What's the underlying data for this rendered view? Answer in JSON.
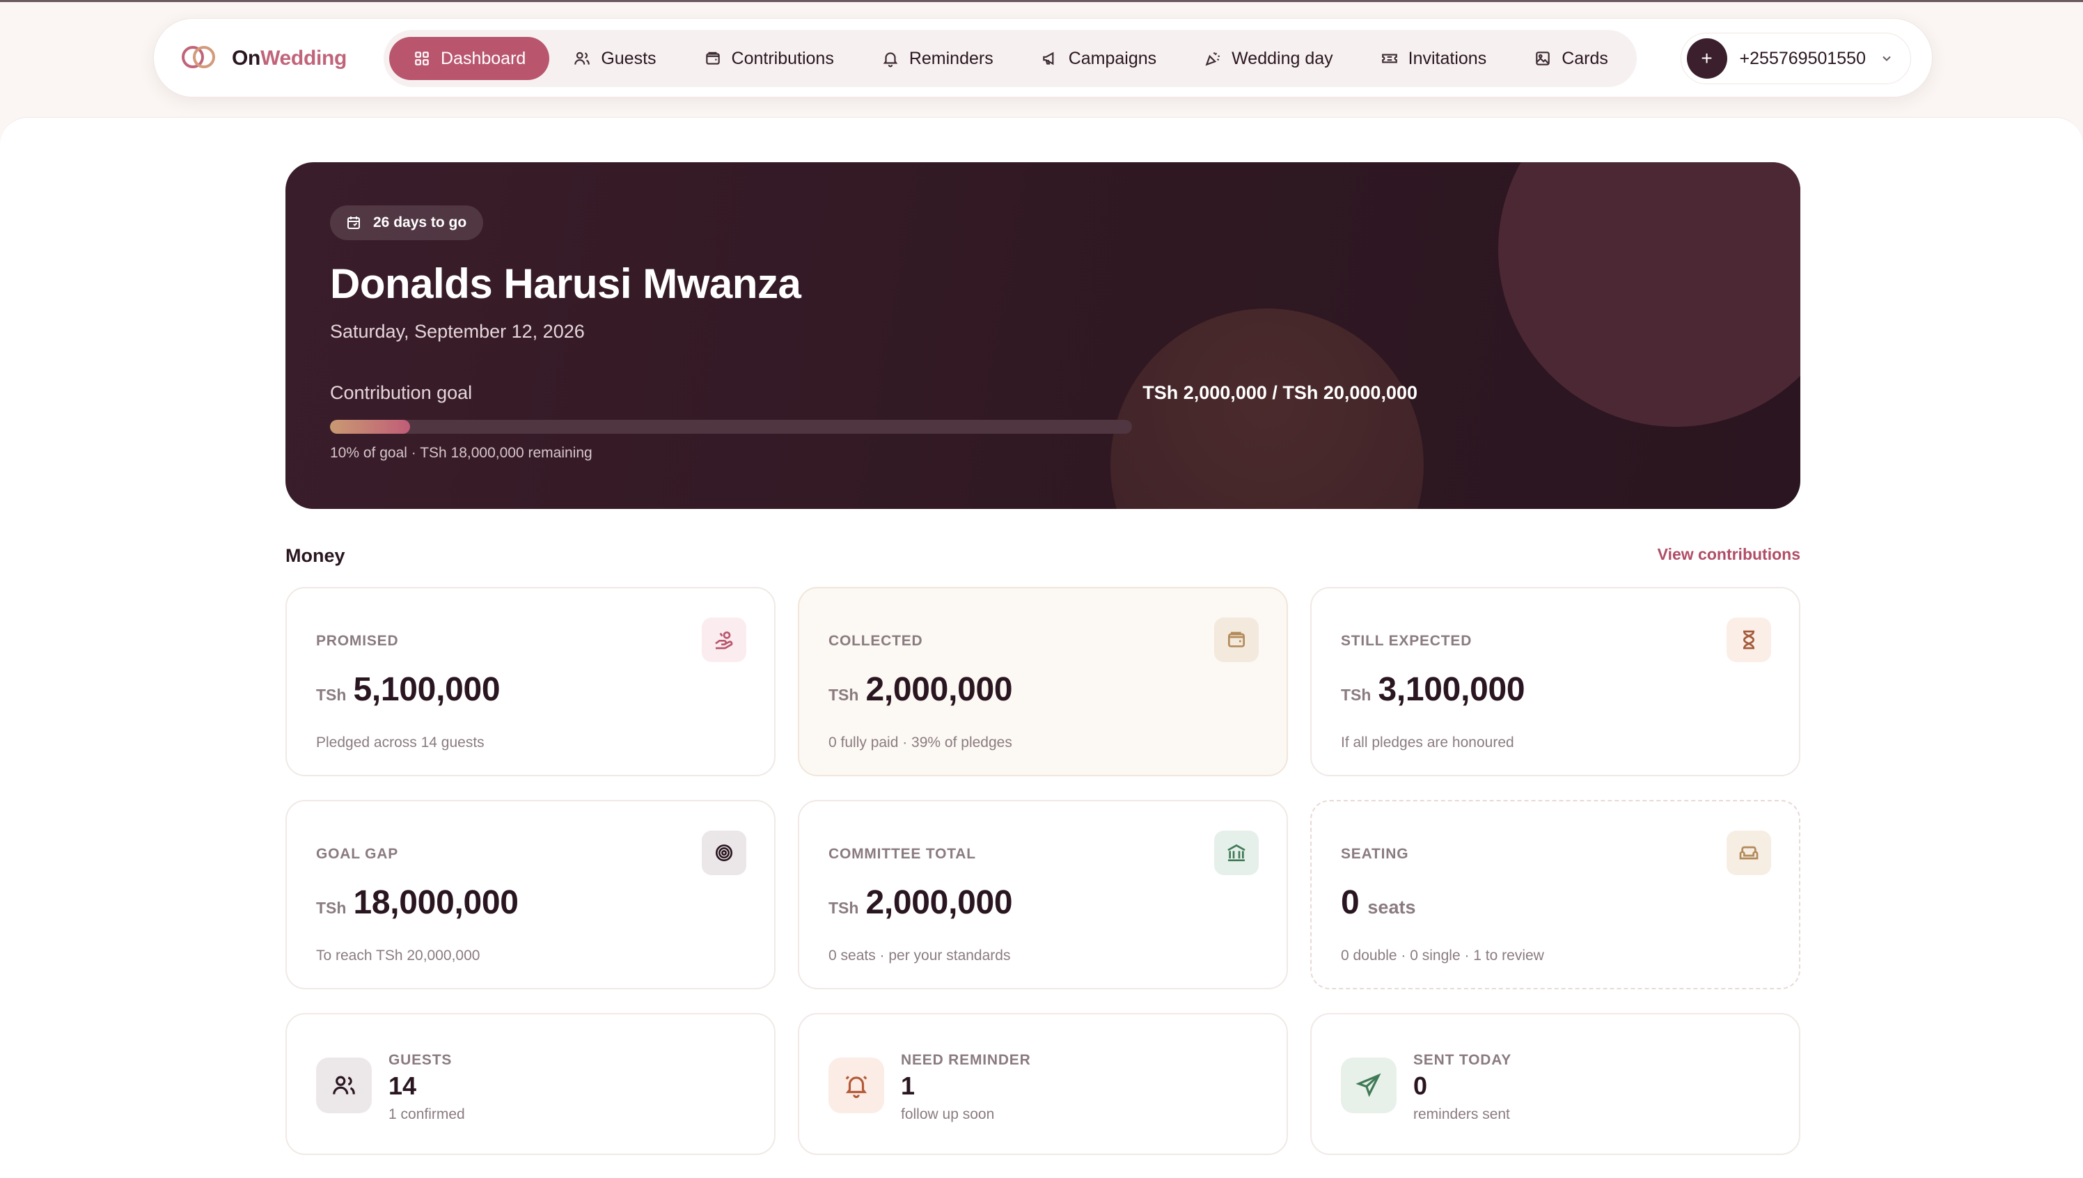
{
  "app": {
    "brand_on": "On",
    "brand_wedding": "Wedding"
  },
  "nav": {
    "tabs": [
      {
        "label": "Dashboard",
        "icon": "grid-icon",
        "active": true
      },
      {
        "label": "Guests",
        "icon": "users-icon"
      },
      {
        "label": "Contributions",
        "icon": "wallet-icon"
      },
      {
        "label": "Reminders",
        "icon": "bell-icon"
      },
      {
        "label": "Campaigns",
        "icon": "megaphone-icon"
      },
      {
        "label": "Wedding day",
        "icon": "party-icon"
      },
      {
        "label": "Invitations",
        "icon": "ticket-icon"
      },
      {
        "label": "Cards",
        "icon": "image-icon"
      }
    ],
    "account": {
      "plus": "+",
      "phone": "+255769501550"
    }
  },
  "hero": {
    "countdown": "26 days to go",
    "title": "Donalds Harusi Mwanza",
    "date": "Saturday, September 12, 2026",
    "goal_label": "Contribution goal",
    "goal_amount": "TSh 2,000,000 / TSh 20,000,000",
    "progress_fraction": 0.1,
    "goal_note": "10% of goal · TSh 18,000,000 remaining"
  },
  "money": {
    "title": "Money",
    "link": "View contributions",
    "cards": {
      "promised": {
        "label": "PROMISED",
        "currency": "TSh",
        "value": "5,100,000",
        "sub": "Pledged across 14 guests",
        "icon": "hand-coins-icon"
      },
      "collected": {
        "label": "COLLECTED",
        "currency": "TSh",
        "value": "2,000,000",
        "sub": "0 fully paid · 39% of pledges",
        "icon": "wallet-icon"
      },
      "still_expected": {
        "label": "STILL EXPECTED",
        "currency": "TSh",
        "value": "3,100,000",
        "sub": "If all pledges are honoured",
        "icon": "hourglass-icon"
      },
      "goal_gap": {
        "label": "GOAL GAP",
        "currency": "TSh",
        "value": "18,000,000",
        "sub": "To reach TSh 20,000,000",
        "icon": "target-icon"
      },
      "committee_total": {
        "label": "COMMITTEE TOTAL",
        "currency": "TSh",
        "value": "2,000,000",
        "sub": "0 seats · per your standards",
        "icon": "bank-icon"
      },
      "seating": {
        "label": "SEATING",
        "value": "0",
        "unit": "seats",
        "sub": "0 double · 0 single · 1 to review",
        "icon": "sofa-icon"
      }
    }
  },
  "stats": {
    "guests": {
      "label": "GUESTS",
      "value": "14",
      "sub": "1 confirmed",
      "icon": "users-icon"
    },
    "need_reminder": {
      "label": "NEED REMINDER",
      "value": "1",
      "sub": "follow up soon",
      "icon": "bell-ring-icon"
    },
    "sent_today": {
      "label": "SENT TODAY",
      "value": "0",
      "sub": "reminders sent",
      "icon": "send-icon"
    }
  },
  "colors": {
    "accent": "#b9566e",
    "hero_bg": "#321a25",
    "text": "#2a1620",
    "muted": "#8a7b80"
  }
}
